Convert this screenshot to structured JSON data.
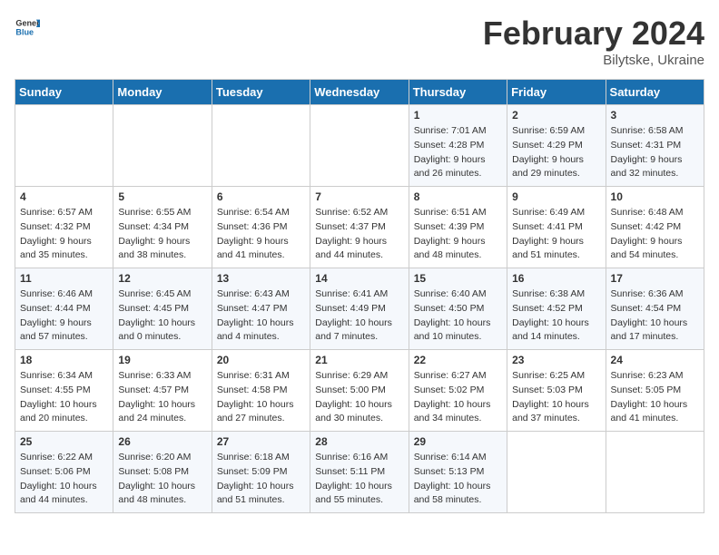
{
  "header": {
    "logo_general": "General",
    "logo_blue": "Blue",
    "title": "February 2024",
    "location": "Bilytske, Ukraine"
  },
  "days_of_week": [
    "Sunday",
    "Monday",
    "Tuesday",
    "Wednesday",
    "Thursday",
    "Friday",
    "Saturday"
  ],
  "weeks": [
    [
      {
        "day": null,
        "sunrise": null,
        "sunset": null,
        "daylight": null
      },
      {
        "day": null,
        "sunrise": null,
        "sunset": null,
        "daylight": null
      },
      {
        "day": null,
        "sunrise": null,
        "sunset": null,
        "daylight": null
      },
      {
        "day": null,
        "sunrise": null,
        "sunset": null,
        "daylight": null
      },
      {
        "day": "1",
        "sunrise": "7:01 AM",
        "sunset": "4:28 PM",
        "daylight": "9 hours and 26 minutes."
      },
      {
        "day": "2",
        "sunrise": "6:59 AM",
        "sunset": "4:29 PM",
        "daylight": "9 hours and 29 minutes."
      },
      {
        "day": "3",
        "sunrise": "6:58 AM",
        "sunset": "4:31 PM",
        "daylight": "9 hours and 32 minutes."
      }
    ],
    [
      {
        "day": "4",
        "sunrise": "6:57 AM",
        "sunset": "4:32 PM",
        "daylight": "9 hours and 35 minutes."
      },
      {
        "day": "5",
        "sunrise": "6:55 AM",
        "sunset": "4:34 PM",
        "daylight": "9 hours and 38 minutes."
      },
      {
        "day": "6",
        "sunrise": "6:54 AM",
        "sunset": "4:36 PM",
        "daylight": "9 hours and 41 minutes."
      },
      {
        "day": "7",
        "sunrise": "6:52 AM",
        "sunset": "4:37 PM",
        "daylight": "9 hours and 44 minutes."
      },
      {
        "day": "8",
        "sunrise": "6:51 AM",
        "sunset": "4:39 PM",
        "daylight": "9 hours and 48 minutes."
      },
      {
        "day": "9",
        "sunrise": "6:49 AM",
        "sunset": "4:41 PM",
        "daylight": "9 hours and 51 minutes."
      },
      {
        "day": "10",
        "sunrise": "6:48 AM",
        "sunset": "4:42 PM",
        "daylight": "9 hours and 54 minutes."
      }
    ],
    [
      {
        "day": "11",
        "sunrise": "6:46 AM",
        "sunset": "4:44 PM",
        "daylight": "9 hours and 57 minutes."
      },
      {
        "day": "12",
        "sunrise": "6:45 AM",
        "sunset": "4:45 PM",
        "daylight": "10 hours and 0 minutes."
      },
      {
        "day": "13",
        "sunrise": "6:43 AM",
        "sunset": "4:47 PM",
        "daylight": "10 hours and 4 minutes."
      },
      {
        "day": "14",
        "sunrise": "6:41 AM",
        "sunset": "4:49 PM",
        "daylight": "10 hours and 7 minutes."
      },
      {
        "day": "15",
        "sunrise": "6:40 AM",
        "sunset": "4:50 PM",
        "daylight": "10 hours and 10 minutes."
      },
      {
        "day": "16",
        "sunrise": "6:38 AM",
        "sunset": "4:52 PM",
        "daylight": "10 hours and 14 minutes."
      },
      {
        "day": "17",
        "sunrise": "6:36 AM",
        "sunset": "4:54 PM",
        "daylight": "10 hours and 17 minutes."
      }
    ],
    [
      {
        "day": "18",
        "sunrise": "6:34 AM",
        "sunset": "4:55 PM",
        "daylight": "10 hours and 20 minutes."
      },
      {
        "day": "19",
        "sunrise": "6:33 AM",
        "sunset": "4:57 PM",
        "daylight": "10 hours and 24 minutes."
      },
      {
        "day": "20",
        "sunrise": "6:31 AM",
        "sunset": "4:58 PM",
        "daylight": "10 hours and 27 minutes."
      },
      {
        "day": "21",
        "sunrise": "6:29 AM",
        "sunset": "5:00 PM",
        "daylight": "10 hours and 30 minutes."
      },
      {
        "day": "22",
        "sunrise": "6:27 AM",
        "sunset": "5:02 PM",
        "daylight": "10 hours and 34 minutes."
      },
      {
        "day": "23",
        "sunrise": "6:25 AM",
        "sunset": "5:03 PM",
        "daylight": "10 hours and 37 minutes."
      },
      {
        "day": "24",
        "sunrise": "6:23 AM",
        "sunset": "5:05 PM",
        "daylight": "10 hours and 41 minutes."
      }
    ],
    [
      {
        "day": "25",
        "sunrise": "6:22 AM",
        "sunset": "5:06 PM",
        "daylight": "10 hours and 44 minutes."
      },
      {
        "day": "26",
        "sunrise": "6:20 AM",
        "sunset": "5:08 PM",
        "daylight": "10 hours and 48 minutes."
      },
      {
        "day": "27",
        "sunrise": "6:18 AM",
        "sunset": "5:09 PM",
        "daylight": "10 hours and 51 minutes."
      },
      {
        "day": "28",
        "sunrise": "6:16 AM",
        "sunset": "5:11 PM",
        "daylight": "10 hours and 55 minutes."
      },
      {
        "day": "29",
        "sunrise": "6:14 AM",
        "sunset": "5:13 PM",
        "daylight": "10 hours and 58 minutes."
      },
      {
        "day": null,
        "sunrise": null,
        "sunset": null,
        "daylight": null
      },
      {
        "day": null,
        "sunrise": null,
        "sunset": null,
        "daylight": null
      }
    ]
  ]
}
